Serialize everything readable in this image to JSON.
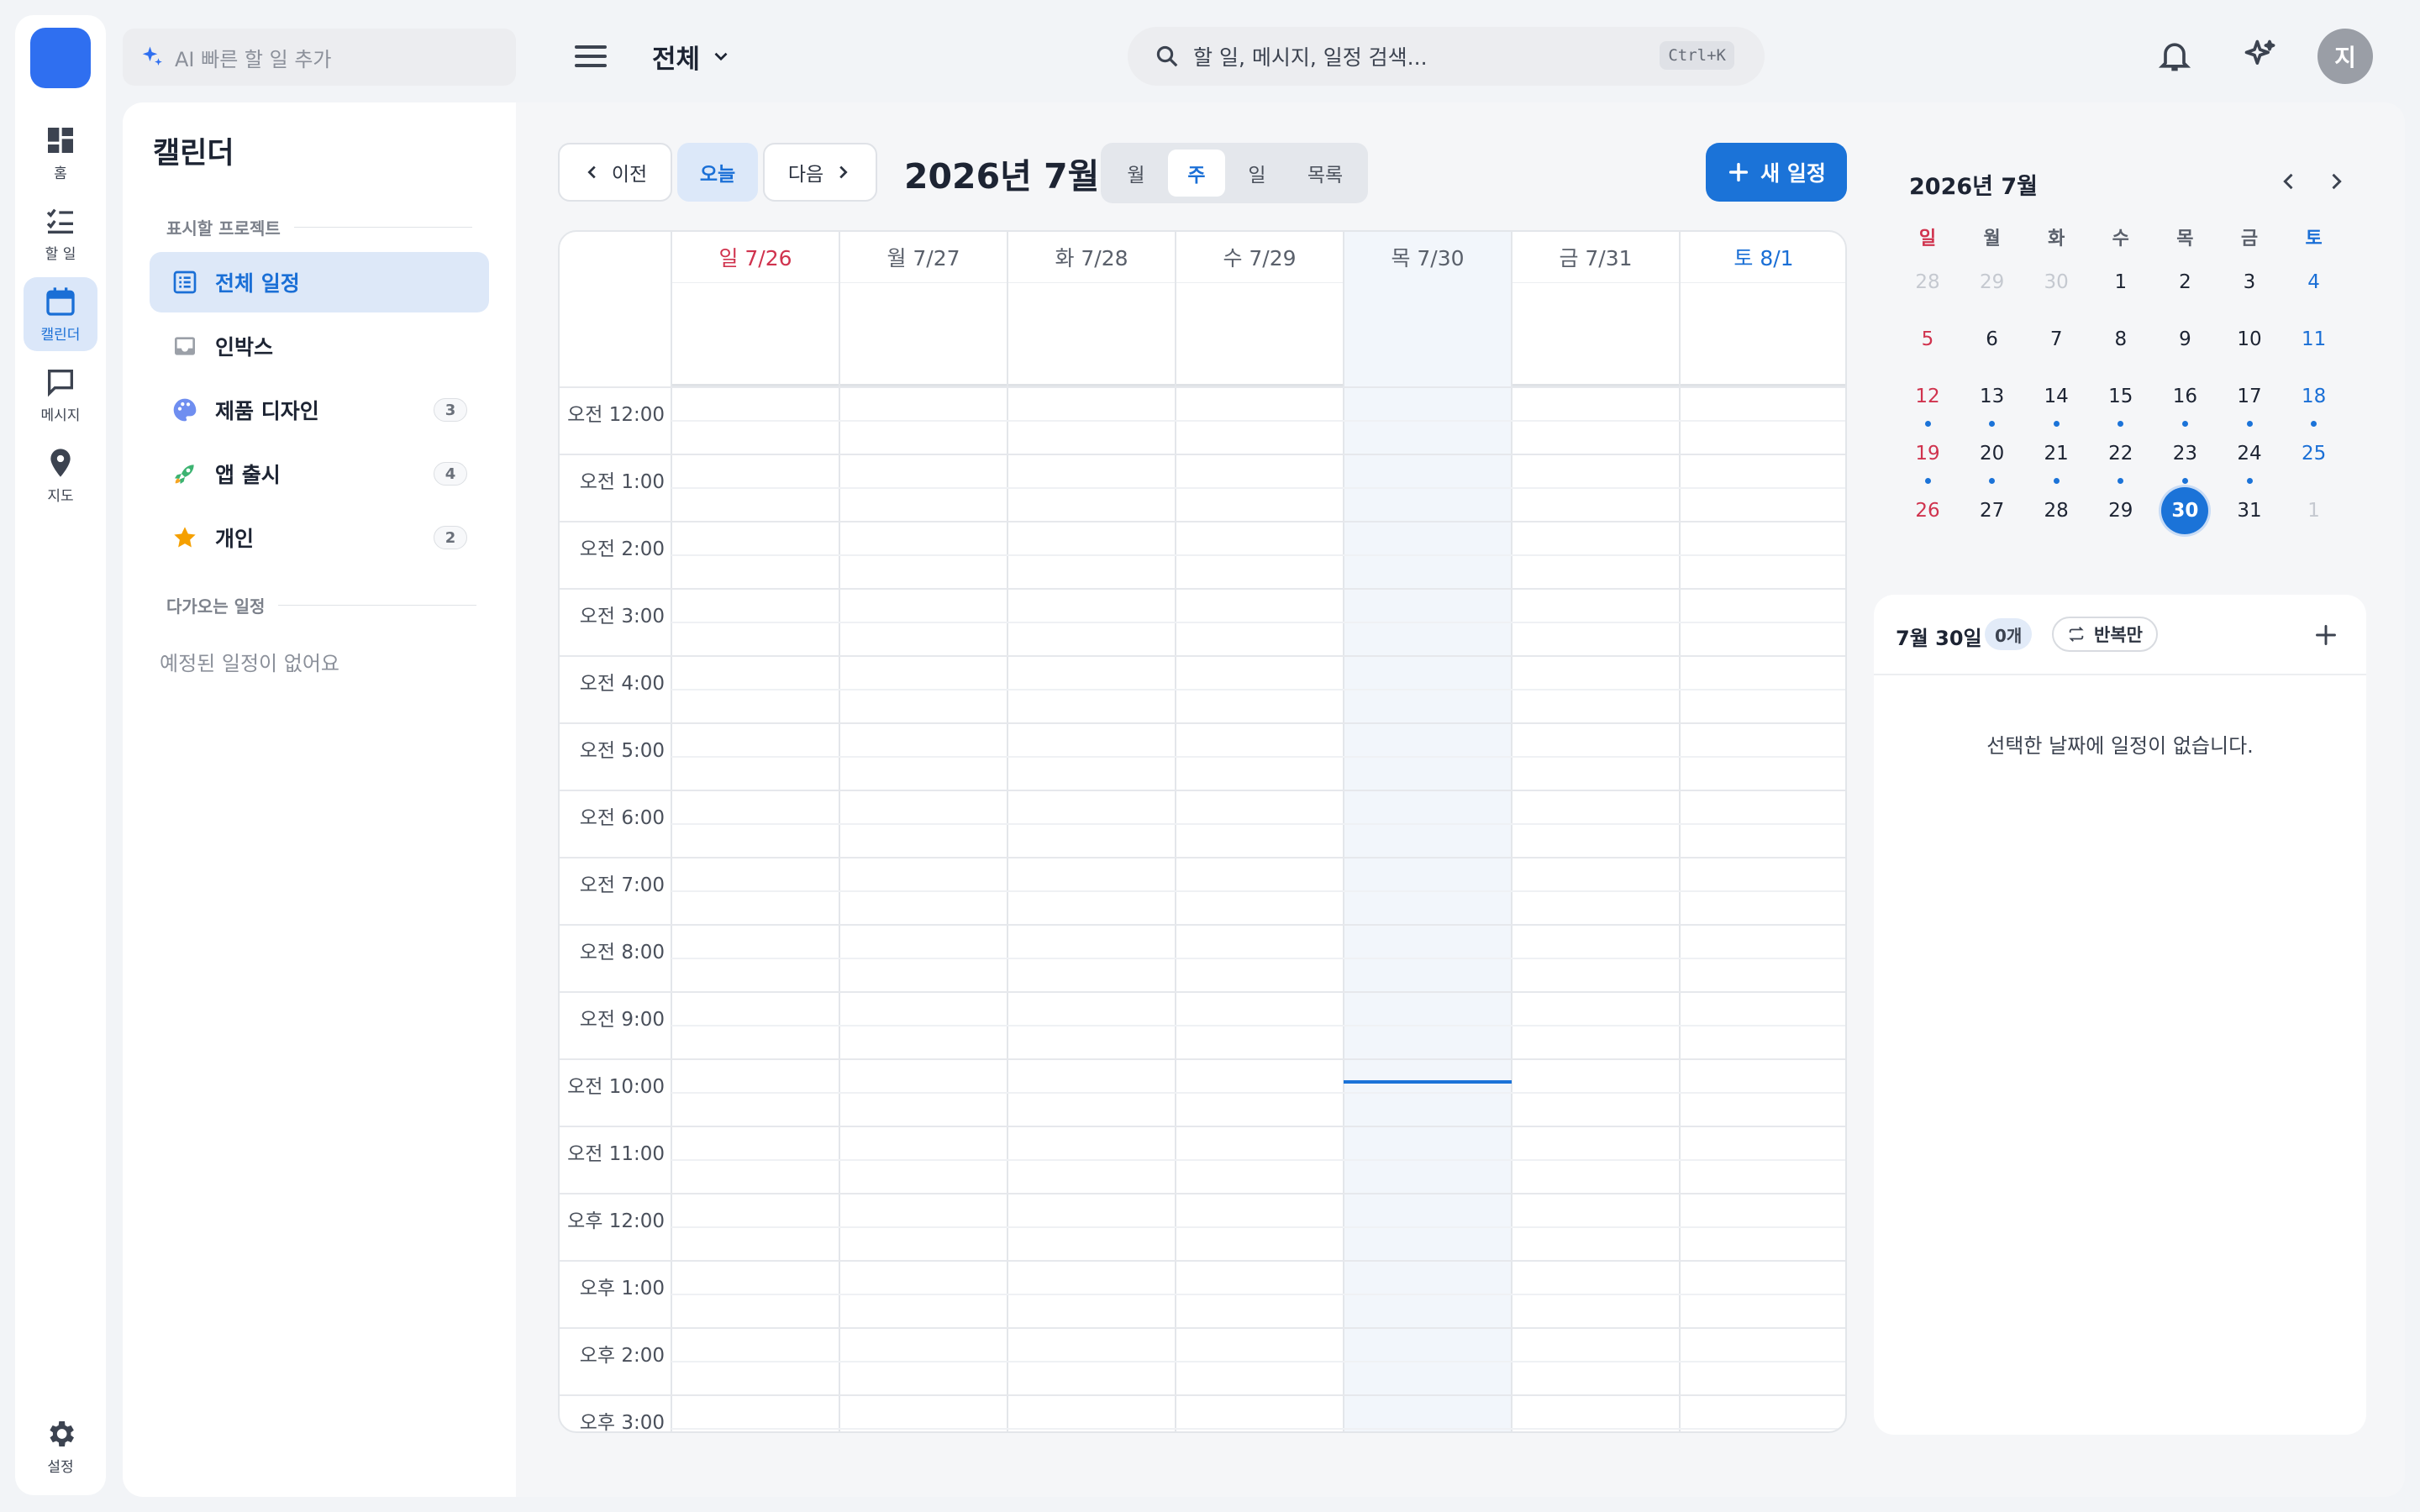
{
  "rail": {
    "items": [
      {
        "label": "홈",
        "icon": "dashboard-icon"
      },
      {
        "label": "할 일",
        "icon": "checklist-icon"
      },
      {
        "label": "캘린더",
        "icon": "calendar-icon"
      },
      {
        "label": "메시지",
        "icon": "message-icon"
      },
      {
        "label": "지도",
        "icon": "map-pin-icon"
      }
    ],
    "settings_label": "설정"
  },
  "topbar": {
    "ai_placeholder": "AI 빠른 할 일 추가",
    "scope": "전체",
    "search_placeholder": "할 일, 메시지, 일정 검색...",
    "search_shortcut": "Ctrl+K",
    "avatar_initial": "지"
  },
  "sidebar": {
    "title": "캘린더",
    "projects_heading": "표시할 프로젝트",
    "projects": [
      {
        "label": "전체 일정",
        "icon": "list-icon",
        "count": ""
      },
      {
        "label": "인박스",
        "icon": "inbox-icon",
        "count": ""
      },
      {
        "label": "제품 디자인",
        "icon": "palette-icon",
        "count": "3"
      },
      {
        "label": "앱 출시",
        "icon": "rocket-icon",
        "count": "4"
      },
      {
        "label": "개인",
        "icon": "star-icon",
        "count": "2"
      }
    ],
    "upcoming_heading": "다가오는 일정",
    "upcoming_empty": "예정된 일정이 없어요"
  },
  "toolbar": {
    "prev_label": "이전",
    "today_label": "오늘",
    "next_label": "다음",
    "month_title": "2026년 7월",
    "views": [
      "월",
      "주",
      "일",
      "목록"
    ],
    "active_view": "주",
    "new_event_label": "새 일정"
  },
  "week": {
    "days": [
      "일 7/26",
      "월 7/27",
      "화 7/28",
      "수 7/29",
      "목 7/30",
      "금 7/31",
      "토 8/1"
    ],
    "times": [
      "오전 12:00",
      "오전 1:00",
      "오전 2:00",
      "오전 3:00",
      "오전 4:00",
      "오전 5:00",
      "오전 6:00",
      "오전 7:00",
      "오전 8:00",
      "오전 9:00",
      "오전 10:00",
      "오전 11:00",
      "오후 12:00",
      "오후 1:00",
      "오후 2:00",
      "오후 3:00"
    ]
  },
  "mini_calendar": {
    "title": "2026년 7월",
    "weekdays": [
      "일",
      "월",
      "화",
      "수",
      "목",
      "금",
      "토"
    ],
    "weeks": [
      [
        "28",
        "29",
        "30",
        "1",
        "2",
        "3",
        "4"
      ],
      [
        "5",
        "6",
        "7",
        "8",
        "9",
        "10",
        "11"
      ],
      [
        "12",
        "13",
        "14",
        "15",
        "16",
        "17",
        "18"
      ],
      [
        "19",
        "20",
        "21",
        "22",
        "23",
        "24",
        "25"
      ],
      [
        "26",
        "27",
        "28",
        "29",
        "30",
        "31",
        "1"
      ]
    ],
    "selected": "30"
  },
  "day_detail": {
    "title": "7월 30일",
    "count": "0개",
    "repeat_label": "반복만",
    "empty_text": "선택한 날짜에 일정이 없습니다."
  },
  "colors": {
    "accent": "#1b73d8",
    "sunday": "#d0334e",
    "saturday": "#1a6fd6"
  }
}
